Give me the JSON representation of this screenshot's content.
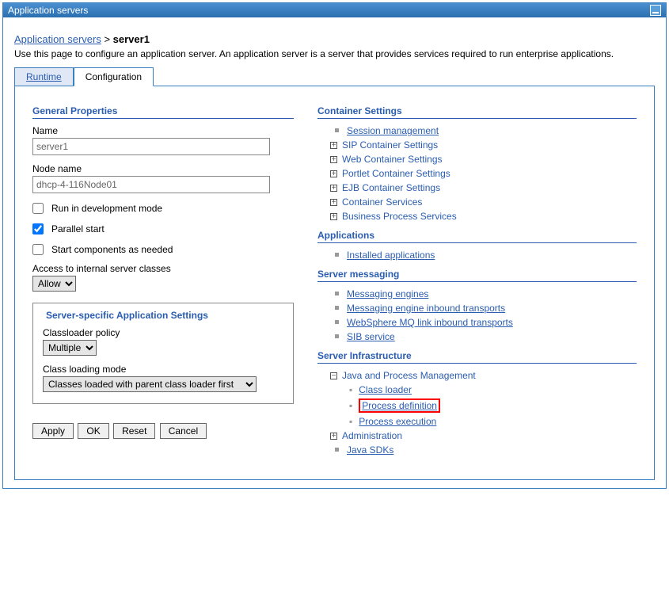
{
  "window": {
    "title": "Application servers"
  },
  "breadcrumb": {
    "root": "Application servers",
    "sep": " > ",
    "leaf": "server1"
  },
  "description": "Use this page to configure an application server. An application server is a server that provides services required to run enterprise applications.",
  "tabs": {
    "runtime": "Runtime",
    "config": "Configuration"
  },
  "general": {
    "heading": "General Properties",
    "name_label": "Name",
    "name_value": "server1",
    "node_label": "Node name",
    "node_value": "dhcp-4-116Node01",
    "cb_dev": "Run in development mode",
    "cb_parallel": "Parallel start",
    "cb_components": "Start components as needed",
    "access_label": "Access to internal server classes",
    "access_value": "Allow"
  },
  "serverspec": {
    "legend": "Server-specific Application Settings",
    "classloader_label": "Classloader policy",
    "classloader_value": "Multiple",
    "classmode_label": "Class loading mode",
    "classmode_value": "Classes loaded with parent class loader first"
  },
  "buttons": {
    "apply": "Apply",
    "ok": "OK",
    "reset": "Reset",
    "cancel": "Cancel"
  },
  "container": {
    "heading": "Container Settings",
    "session": "Session management",
    "sip": "SIP Container Settings",
    "web": "Web Container Settings",
    "portlet": "Portlet Container Settings",
    "ejb": "EJB Container Settings",
    "services": "Container Services",
    "bps": "Business Process Services"
  },
  "applications": {
    "heading": "Applications",
    "installed": "Installed applications"
  },
  "messaging": {
    "heading": "Server messaging",
    "engines": "Messaging engines",
    "inbound": "Messaging engine inbound transports",
    "mq": "WebSphere MQ link inbound transports",
    "sib": "SIB service"
  },
  "infra": {
    "heading": "Server Infrastructure",
    "jpm": "Java and Process Management",
    "classloader": "Class loader",
    "procdef": "Process definition",
    "procexec": "Process execution",
    "admin": "Administration",
    "sdks": "Java SDKs"
  }
}
